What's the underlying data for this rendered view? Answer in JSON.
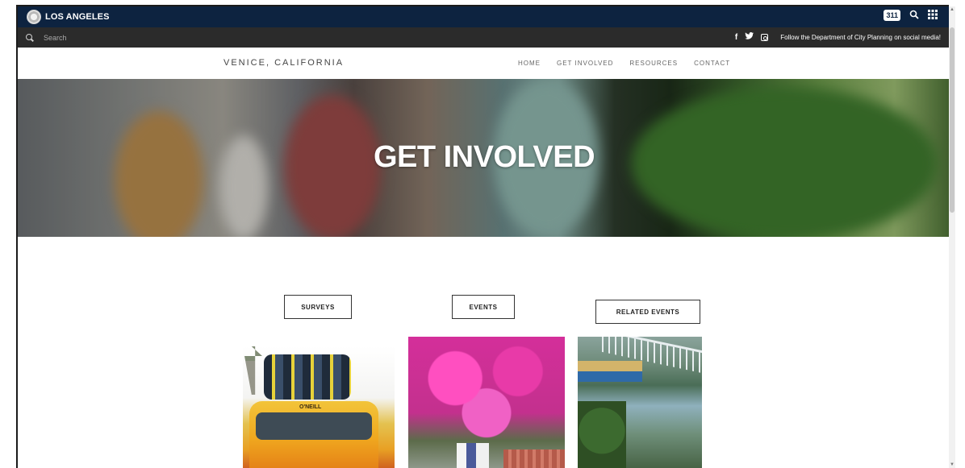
{
  "citybar": {
    "name": "LOS ANGELES",
    "badge": "311",
    "search_icon": "search-icon",
    "apps_icon": "grid-apps-icon"
  },
  "searchbar": {
    "placeholder": "Search",
    "social": {
      "facebook": "f",
      "twitter": "twitter-bird",
      "instagram": "instagram",
      "follow_text": "Follow the Department of City Planning on social media!"
    }
  },
  "sitenav": {
    "title": "VENICE, CALIFORNIA",
    "items": [
      {
        "label": "HOME"
      },
      {
        "label": "GET INVOLVED"
      },
      {
        "label": "RESOURCES"
      },
      {
        "label": "CONTACT"
      }
    ]
  },
  "hero": {
    "title": "GET INVOLVED"
  },
  "sections": [
    {
      "label": "SURVEYS"
    },
    {
      "label": "EVENTS"
    },
    {
      "label": "RELATED EVENTS"
    }
  ],
  "photos": {
    "van_text": "O'NEILL"
  }
}
